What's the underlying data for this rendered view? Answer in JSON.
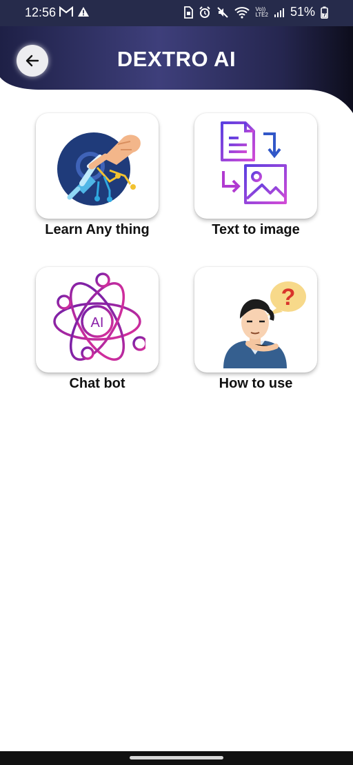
{
  "status_bar": {
    "time": "12:56",
    "left_icons": [
      "gmail-icon",
      "warning-icon"
    ],
    "right_icons": [
      "sim-icon",
      "alarm-icon",
      "mute-icon",
      "wifi-icon",
      "volte-icon",
      "signal-icon"
    ],
    "volte_text_top": "Vo))",
    "volte_text_bottom": "LTE2",
    "battery": "51%"
  },
  "header": {
    "title": "DEXTRO AI",
    "back_icon": "arrow-left-icon",
    "colors": {
      "dark": "#1b1d40",
      "mid": "#3d3f7a",
      "edge": "#0f1020"
    }
  },
  "menu": {
    "items": [
      {
        "label": "Learn Any thing",
        "icon": "robot-hand-touch-icon"
      },
      {
        "label": "Text to image",
        "icon": "text-to-image-icon"
      },
      {
        "label": "Chat bot",
        "icon": "ai-atom-icon"
      },
      {
        "label": "How to use",
        "icon": "confused-person-icon"
      }
    ]
  }
}
